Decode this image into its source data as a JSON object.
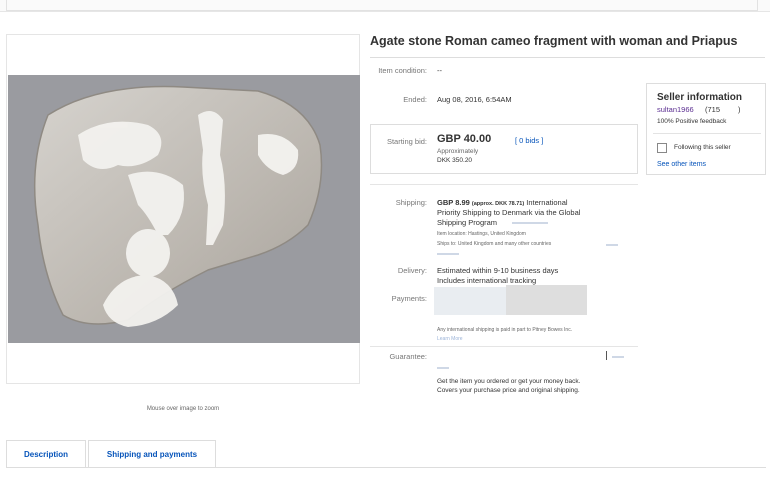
{
  "listing": {
    "title": "Agate stone Roman cameo fragment with woman and Priapus",
    "zoom_hint": "Mouse over image to zoom"
  },
  "details": {
    "condition_label": "Item condition:",
    "condition_value": "--",
    "ended_label": "Ended:",
    "ended_value": "Aug 08, 2016, 6:54AM"
  },
  "bid": {
    "label": "Starting bid:",
    "price": "GBP 40.00",
    "bids_link": "[ 0 bids ]",
    "approx_label": "Approximately",
    "approx_value": "DKK 350.20"
  },
  "seller": {
    "title": "Seller information",
    "name": "sultan1966",
    "score": "(715",
    "score_close": ")",
    "feedback": "100% Positive feedback",
    "follow_label": "Following this seller",
    "see_other": "See other items"
  },
  "shipping": {
    "label": "Shipping:",
    "price": "GBP 8.99",
    "approx": "(approx. DKK 78.71)",
    "line1": "International",
    "line2": "Priority Shipping to Denmark",
    "line2b": "via the Global",
    "line3": "Shipping Program",
    "location": "Item location:  Hastings, United Kingdom",
    "ships_to": "Ships to: United Kingdom and many other countries"
  },
  "delivery": {
    "label": "Delivery:",
    "line1": "Estimated within 9-10 business days",
    "line2": "Includes international tracking"
  },
  "payments": {
    "label": "Payments:",
    "note": "Any international shipping is paid in part to Pitney Bowes Inc.",
    "learn_more": "Learn More"
  },
  "guarantee": {
    "label": "Guarantee:",
    "line1": "Get the item you ordered or get your money back.",
    "line2": "Covers your purchase price and original shipping."
  },
  "tabs": [
    {
      "label": "Description"
    },
    {
      "label": "Shipping and payments"
    }
  ],
  "colors": {
    "link": "#0654ba",
    "seller_name": "#5b2e91",
    "image_background": "#9a9ba0"
  }
}
